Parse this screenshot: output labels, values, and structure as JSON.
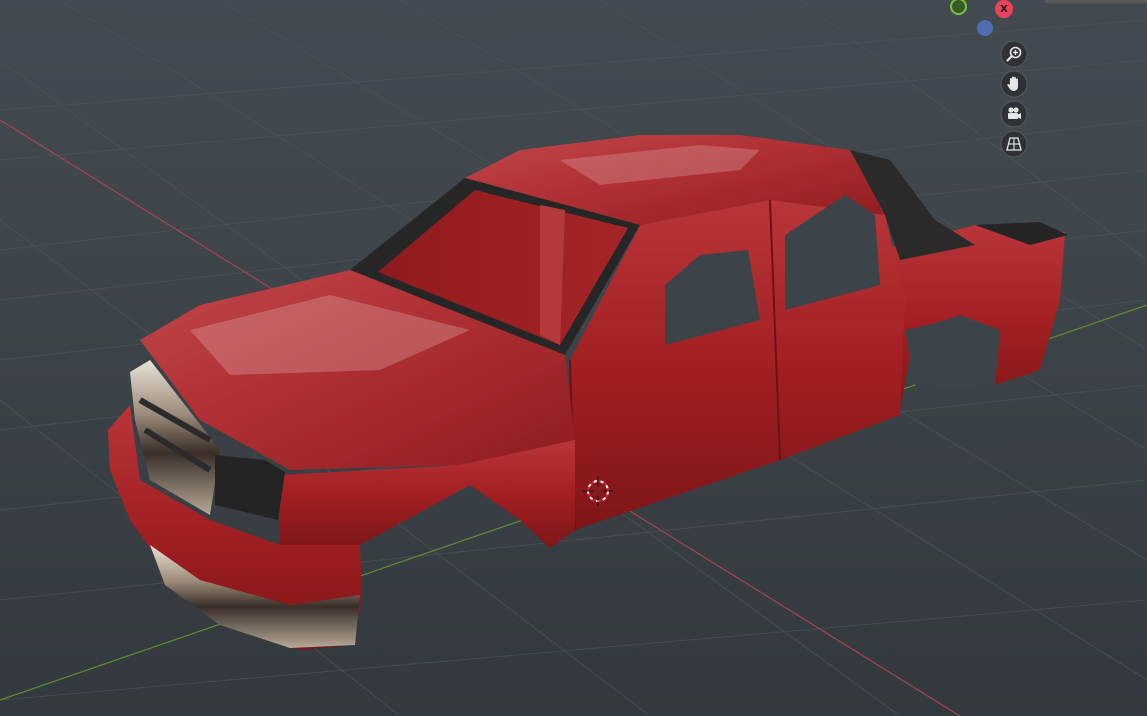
{
  "viewport": {
    "background_top": "#434a51",
    "background_bottom": "#33393e",
    "grid_color": "#4b5258",
    "x_axis_color": "#b0454a",
    "y_axis_color": "#6aa337"
  },
  "gizmo": {
    "x_label": "X",
    "x_color": "#f0405a",
    "y_color": "#7cbf3c",
    "z_color": "#4d6fb0"
  },
  "nav_controls": [
    {
      "name": "zoom",
      "icon": "zoom-in-icon"
    },
    {
      "name": "pan",
      "icon": "hand-icon"
    },
    {
      "name": "camera",
      "icon": "camera-icon"
    },
    {
      "name": "ortho",
      "icon": "grid-perspective-icon"
    }
  ],
  "object": {
    "name": "truck-body",
    "body_color": "#a21f22",
    "trim_color": "#2b2b2b",
    "chrome_color": "#cfc6bb"
  },
  "cursor_3d": {
    "icon": "3d-cursor-icon"
  }
}
